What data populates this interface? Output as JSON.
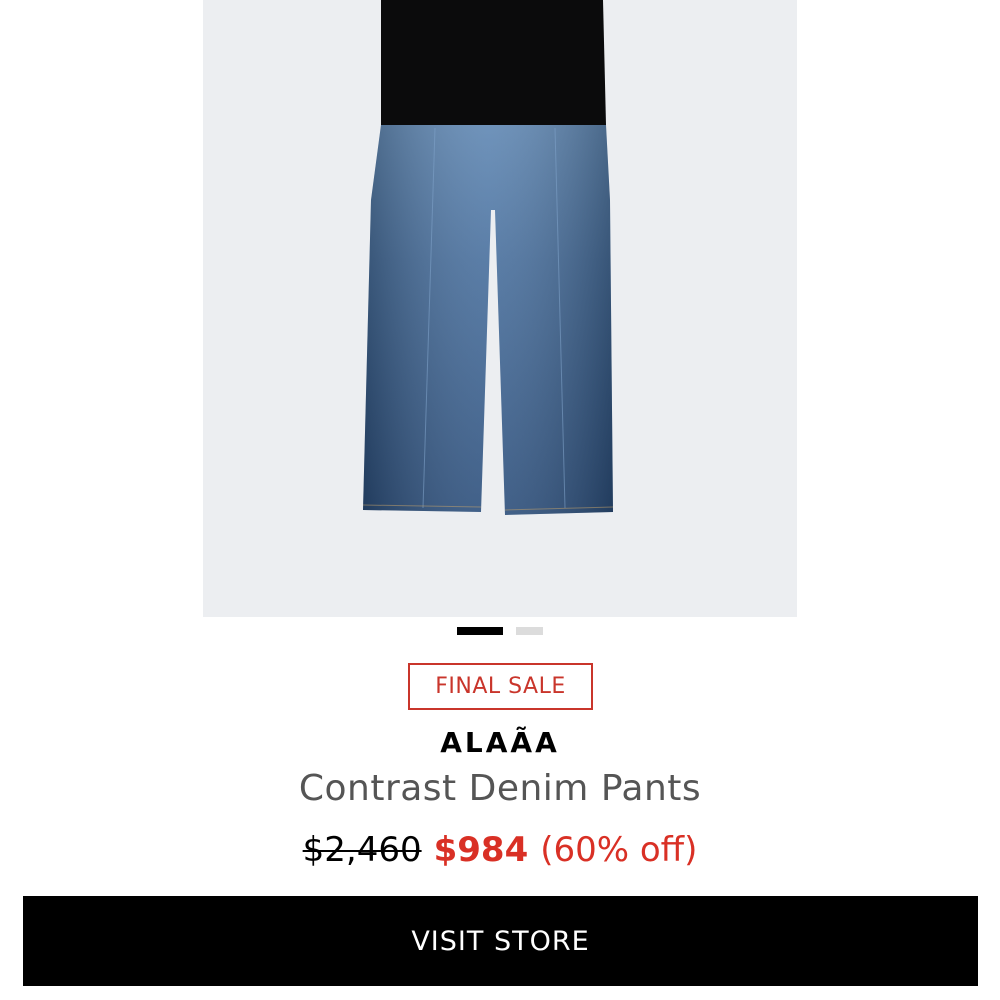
{
  "product": {
    "badge": "FINAL SALE",
    "brand": "ALAÃA",
    "title": "Contrast Denim Pants",
    "price_original": "$2,460",
    "price_sale": "$984",
    "price_discount": "(60% off)",
    "image": {
      "subject": "contrast denim pants",
      "image_count": 2,
      "active_index": 0
    }
  },
  "actions": {
    "visit_store_label": "VISIT STORE"
  },
  "colors": {
    "sale_red": "#d93025",
    "badge_red": "#c9352b",
    "button_bg": "#000000",
    "image_bg": "#eceef1"
  }
}
